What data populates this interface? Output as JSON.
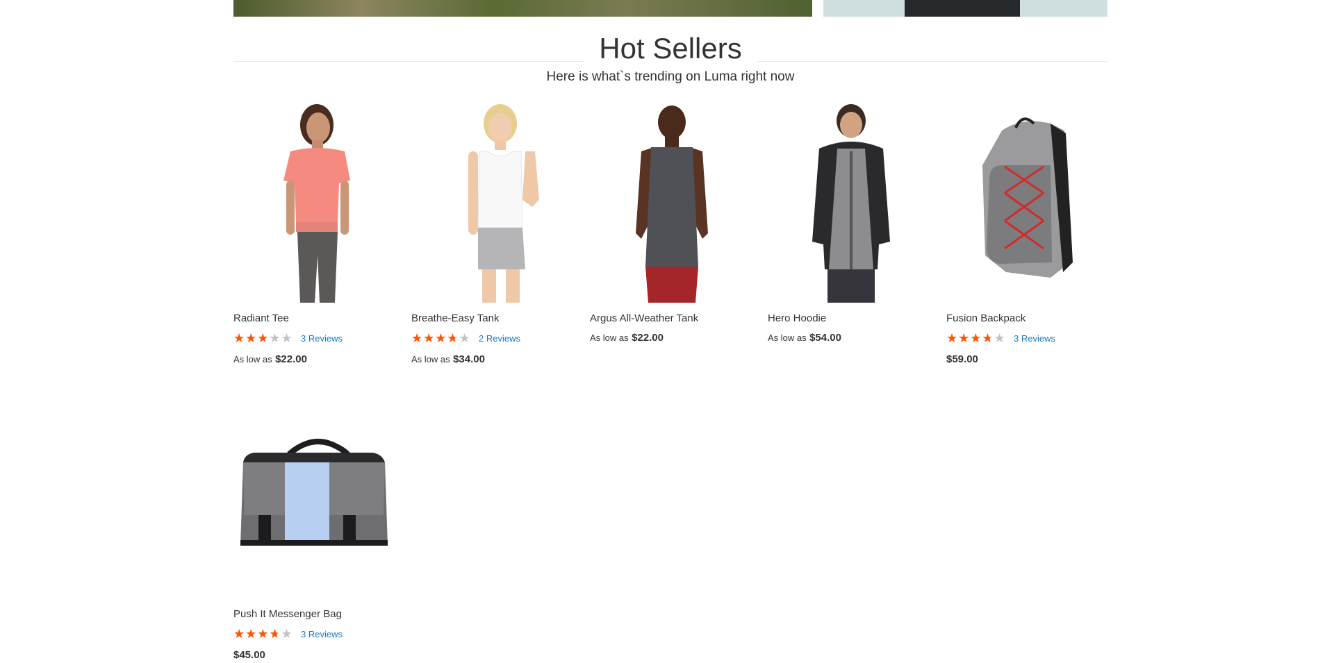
{
  "section": {
    "title": "Hot Sellers",
    "subtitle": "Here is what`s trending on Luma right now"
  },
  "products": [
    {
      "name": "Radiant Tee",
      "rating": 0.6,
      "reviews": "3 Reviews",
      "as_low_as": "As low as",
      "price": "$22.00",
      "image_icon": "pink-tee-model"
    },
    {
      "name": "Breathe-Easy Tank",
      "rating": 0.7,
      "reviews": "2 Reviews",
      "as_low_as": "As low as",
      "price": "$34.00",
      "image_icon": "white-tank-model"
    },
    {
      "name": "Argus All-Weather Tank",
      "rating": null,
      "reviews": "",
      "as_low_as": "As low as",
      "price": "$22.00",
      "image_icon": "grey-tank-model"
    },
    {
      "name": "Hero Hoodie",
      "rating": null,
      "reviews": "",
      "as_low_as": "As low as",
      "price": "$54.00",
      "image_icon": "hoodie-model"
    },
    {
      "name": "Fusion Backpack",
      "rating": 0.7,
      "reviews": "3 Reviews",
      "as_low_as": "",
      "price": "$59.00",
      "image_icon": "backpack"
    },
    {
      "name": "Push It Messenger Bag",
      "rating": 0.7,
      "reviews": "3 Reviews",
      "as_low_as": "",
      "price": "$45.00",
      "image_icon": "messenger-bag"
    }
  ],
  "colors": {
    "star_filled": "#ff5501",
    "star_empty": "#c2c2c2",
    "review_link": "#1979c3",
    "text": "#333333"
  }
}
